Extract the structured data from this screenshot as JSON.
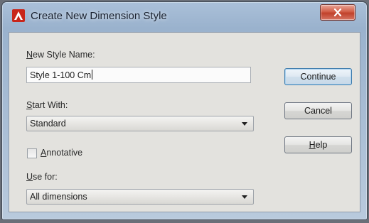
{
  "window": {
    "title": "Create New Dimension Style",
    "close_glyph": "x"
  },
  "new_style_name": {
    "label_first": "N",
    "label_rest": "ew Style Name:",
    "value": "Style 1-100 Cm"
  },
  "start_with": {
    "label_first": "S",
    "label_rest": "tart With:",
    "selected": "Standard"
  },
  "annotative": {
    "label_first": "A",
    "label_rest": "nnotative",
    "checked": false
  },
  "use_for": {
    "label_first": "U",
    "label_rest": "se for:",
    "selected": "All dimensions"
  },
  "buttons": {
    "continue": "Continue",
    "cancel": "Cancel",
    "help_first": "H",
    "help_rest": "elp"
  },
  "icons": {
    "app": "autocad-icon",
    "close": "close-icon",
    "dropdown": "chevron-down-icon"
  }
}
